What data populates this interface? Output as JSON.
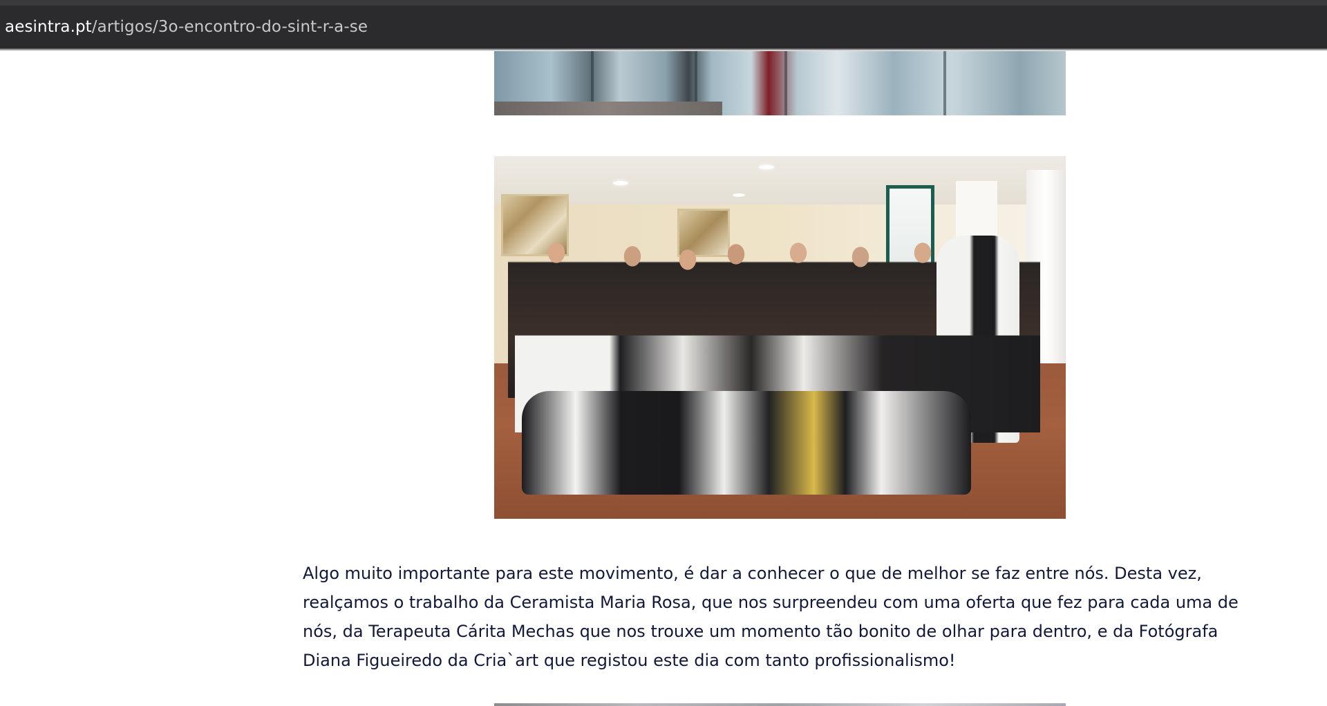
{
  "browser": {
    "url_host": "aesintra.pt",
    "url_path": "/artigos/3o-encontro-do-sint-r-a-se"
  },
  "article": {
    "paragraph": "Algo muito importante para este movimento, é dar a conhecer o que de melhor se faz entre nós. Desta vez, realçamos o trabalho da Ceramista Maria Rosa, que nos surpreendeu com uma oferta que fez para cada uma de nós, da Terapeuta Cárita Mechas que nos trouxe um momento tão bonito de olhar para dentro, e da Fotógrafa Diana Figueiredo da Cria`art que registou este dia com tanto profissionalismo!"
  },
  "colors": {
    "urlbar_bg": "#2b2b2d",
    "text": "#12183a",
    "page_bg": "#ffffff"
  }
}
